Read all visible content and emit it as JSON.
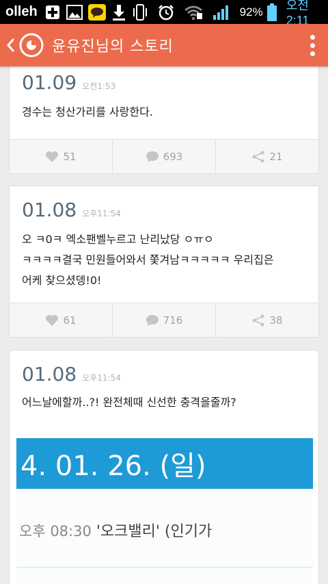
{
  "status_bar": {
    "carrier": "olleh",
    "battery": "92%",
    "time": "오전 2:11"
  },
  "app_bar": {
    "title": "윤유진님의 스토리"
  },
  "posts": [
    {
      "date": "01.09",
      "time": "오전1:53",
      "lines": [
        "경수는 청산가리를 사랑한다."
      ],
      "likes": "51",
      "comments": "693",
      "shares": "21"
    },
    {
      "date": "01.08",
      "time": "오후11:54",
      "lines": [
        "오 ㅋ0ㅋ 엑소팬벨누르고 난리났당 ㅇㅠㅇ",
        "ㅋㅋㅋㅋ결국 민원들어와서 쫓겨남ㅋㅋㅋㅋㅋ 우리집은",
        "어케 찾으셨뎅!0!"
      ],
      "likes": "61",
      "comments": "716",
      "shares": "38"
    },
    {
      "date": "01.08",
      "time": "오후11:54",
      "lines": [
        "어느날에할까..?! 완전체때 신선한 충격을줄까?"
      ],
      "image": {
        "banner": "4. 01. 26. (일)",
        "time_text": "오후 08:30",
        "rest_text": "'오크밸리' (인기가"
      }
    }
  ]
}
